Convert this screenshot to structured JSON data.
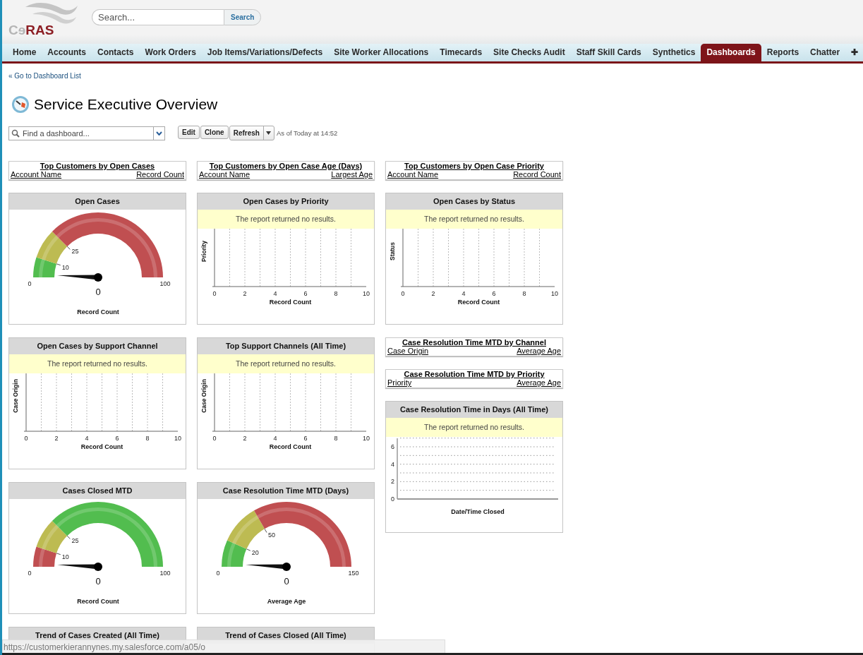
{
  "header": {
    "logo": {
      "prefix": "Cɘ",
      "suffix": "RAS"
    },
    "search": {
      "placeholder": "Search...",
      "button": "Search"
    }
  },
  "tabs": [
    {
      "label": "Home",
      "selected": false
    },
    {
      "label": "Accounts",
      "selected": false
    },
    {
      "label": "Contacts",
      "selected": false
    },
    {
      "label": "Work Orders",
      "selected": false
    },
    {
      "label": "Job Items/Variations/Defects",
      "selected": false
    },
    {
      "label": "Site Worker Allocations",
      "selected": false
    },
    {
      "label": "Timecards",
      "selected": false
    },
    {
      "label": "Site Checks Audit",
      "selected": false
    },
    {
      "label": "Staff Skill Cards",
      "selected": false
    },
    {
      "label": "Synthetics",
      "selected": false
    },
    {
      "label": "Dashboards",
      "selected": true
    },
    {
      "label": "Reports",
      "selected": false
    },
    {
      "label": "Chatter",
      "selected": false
    }
  ],
  "more_tab": "✚",
  "back_link": "« Go to Dashboard List",
  "title": "Service Executive Overview",
  "toolbar": {
    "finder_placeholder": "Find a dashboard...",
    "buttons": [
      "Edit",
      "Clone",
      "Refresh"
    ],
    "timestamp": "As of Today at 14:52"
  },
  "columns": [
    [
      {
        "kind": "table",
        "title": "Top Customers by Open Cases",
        "columns": [
          "Account Name",
          "Record Count"
        ]
      },
      {
        "kind": "gauge",
        "title": "Open Cases",
        "min": "0",
        "max": "100",
        "value": "0",
        "label": "Record Count",
        "bands": [
          {
            "upto": "10",
            "color": "#52bd4f"
          },
          {
            "upto": "25",
            "color": "#bdbb52"
          },
          {
            "color": "#c04f51"
          }
        ]
      },
      {
        "kind": "chart",
        "title": "Open Cases by Support Channel",
        "message": "The report returned no results.",
        "plot": {
          "kind": "bar",
          "xlabel": "Record Count",
          "ylabel": "Case Origin",
          "xticks": [
            "0",
            "2",
            "4",
            "6",
            "8",
            "10"
          ]
        }
      },
      {
        "kind": "gauge",
        "title": "Cases Closed MTD",
        "min": "0",
        "max": "100",
        "value": "0",
        "label": "Record Count",
        "bands": [
          {
            "upto": "10",
            "color": "#c04f51"
          },
          {
            "upto": "25",
            "color": "#bdbb52"
          },
          {
            "color": "#52bd4f"
          }
        ]
      },
      {
        "kind": "cut",
        "title": "Trend of Cases Created (All Time)"
      }
    ],
    [
      {
        "kind": "table",
        "title": "Top Customers by Open Case Age (Days)",
        "columns": [
          "Account Name",
          "Largest Age"
        ]
      },
      {
        "kind": "chart",
        "title": "Open Cases by Priority",
        "message": "The report returned no results.",
        "plot": {
          "kind": "bar",
          "xlabel": "Record Count",
          "ylabel": "Priority",
          "xticks": [
            "0",
            "2",
            "4",
            "6",
            "8",
            "10"
          ]
        }
      },
      {
        "kind": "chart",
        "title": "Top Support Channels (All Time)",
        "message": "The report returned no results.",
        "plot": {
          "kind": "bar",
          "xlabel": "Record Count",
          "ylabel": "Case Origin",
          "xticks": [
            "0",
            "2",
            "4",
            "6",
            "8",
            "10"
          ]
        }
      },
      {
        "kind": "gauge",
        "title": "Case Resolution Time MTD (Days)",
        "min": "0",
        "max": "150",
        "value": "0",
        "label": "Average Age",
        "bands": [
          {
            "upto": "20",
            "color": "#52bd4f"
          },
          {
            "upto": "50",
            "color": "#bdbb52"
          },
          {
            "color": "#c04f51"
          }
        ]
      },
      {
        "kind": "cut",
        "title": "Trend of Cases Closed (All Time)"
      }
    ],
    [
      {
        "kind": "table",
        "title": "Top Customers by Open Case Priority",
        "columns": [
          "Account Name",
          "Record Count"
        ]
      },
      {
        "kind": "chart",
        "title": "Open Cases by Status",
        "message": "The report returned no results.",
        "plot": {
          "kind": "bar",
          "xlabel": "Record Count",
          "ylabel": "Status",
          "xticks": [
            "0",
            "2",
            "4",
            "6",
            "8",
            "10"
          ]
        }
      },
      {
        "kind": "table",
        "title": "Case Resolution Time MTD by Channel",
        "columns": [
          "Case Origin",
          "Average Age"
        ]
      },
      {
        "kind": "table",
        "title": "Case Resolution Time MTD by Priority",
        "columns": [
          "Priority",
          "Average Age"
        ]
      },
      {
        "kind": "chart",
        "title": "Case Resolution Time in Days (All Time)",
        "message": "The report returned no results.",
        "plot": {
          "kind": "line",
          "xlabel": "Date/Time Closed",
          "yticks": [
            "6",
            "4",
            "2",
            "0"
          ]
        }
      }
    ]
  ],
  "status_url": "https://customerkierannynes.my.salesforce.com/a05/o"
}
